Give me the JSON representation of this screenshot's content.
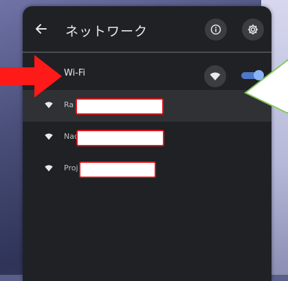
{
  "window": {
    "title": "ネットワーク"
  },
  "header": {
    "back_icon": "arrow-left-icon",
    "info_icon": "info-icon",
    "settings_icon": "gear-icon"
  },
  "wifi": {
    "label": "Wi-Fi",
    "enabled": true,
    "icon": "wifi-icon"
  },
  "networks": [
    {
      "name_prefix": "Ra",
      "redacted": true
    },
    {
      "name_prefix": "Nac",
      "redacted": true
    },
    {
      "name_prefix": "Proj",
      "redacted": true
    }
  ],
  "colors": {
    "panel_bg": "#202124",
    "accent_blue": "#8ab4f8",
    "redaction_border": "#e3141b",
    "annotation_red": "#ff1a1a",
    "annotation_green": "#86c95b"
  }
}
